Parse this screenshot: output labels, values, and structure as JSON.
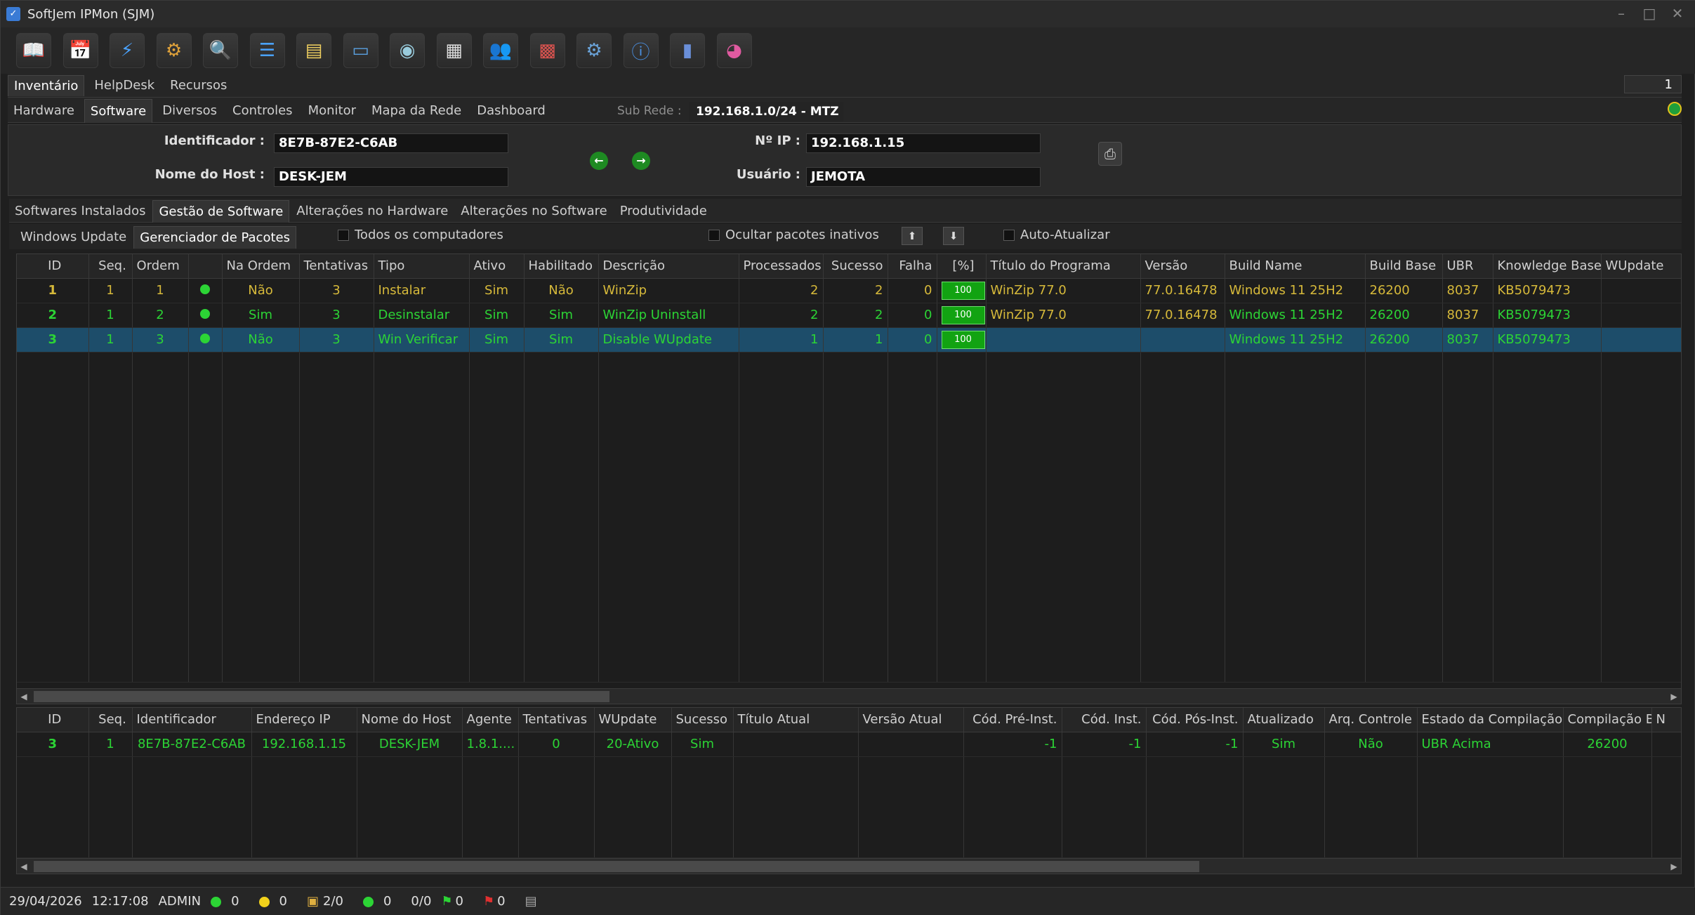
{
  "window": {
    "title": "SoftJem IPMon (SJM)"
  },
  "toolbar": {
    "icons": [
      "open-book-icon",
      "calendar-clock-icon",
      "lightning-icon",
      "gears-icon",
      "search-icon",
      "tree-add-icon",
      "notes-icon",
      "monitor-icon",
      "camera-icon",
      "clipboard-icon",
      "users-icon",
      "chart-report-icon",
      "settings-gear-icon",
      "info-icon",
      "exit-door-icon",
      "palette-icon"
    ]
  },
  "main_tabs": [
    "Inventário",
    "HelpDesk",
    "Recursos"
  ],
  "page_number": "1",
  "section_tabs": [
    "Hardware",
    "Software",
    "Diversos",
    "Controles",
    "Monitor",
    "Mapa da Rede",
    "Dashboard"
  ],
  "subnet": {
    "label": "Sub Rede :",
    "value": "192.168.1.0/24 - MTZ"
  },
  "host": {
    "id_label": "Identificador :",
    "id_value": "8E7B-87E2-C6AB",
    "name_label": "Nome do Host :",
    "name_value": "DESK-JEM",
    "ip_label": "Nº IP :",
    "ip_value": "192.168.1.15",
    "user_label": "Usuário :",
    "user_value": "JEMOTA"
  },
  "software_tabs": [
    "Softwares Instalados",
    "Gestão de Software",
    "Alterações no Hardware",
    "Alterações no Software",
    "Produtividade"
  ],
  "package_tabs": [
    "Windows Update",
    "Gerenciador de Pacotes"
  ],
  "options": {
    "all_computers": "Todos os computadores",
    "hide_inactive": "Ocultar pacotes inativos",
    "auto_update": "Auto-Atualizar"
  },
  "packages": {
    "columns": [
      "ID",
      "Seq.",
      "Ordem",
      "",
      "Na Ordem",
      "Tentativas",
      "Tipo",
      "Ativo",
      "Habilitado",
      "Descrição",
      "Processados",
      "Sucesso",
      "Falha",
      "[%]",
      "Título do Programa",
      "Versão",
      "Build Name",
      "Build Base",
      "UBR",
      "Knowledge Base",
      "WUpdate"
    ],
    "rows": [
      {
        "id": "1",
        "seq": "1",
        "ordem": "1",
        "na_ordem": "Não",
        "tentativas": "3",
        "tipo": "Instalar",
        "ativo": "Sim",
        "habilitado": "Não",
        "descricao": "WinZip",
        "processados": "2",
        "sucesso": "2",
        "falha": "0",
        "pct": "100",
        "titulo": "WinZip 77.0",
        "versao": "77.0.16478",
        "build_name": "Windows 11 25H2",
        "build_base": "26200",
        "ubr": "8037",
        "kb": "KB5079473",
        "wupdate": ""
      },
      {
        "id": "2",
        "seq": "1",
        "ordem": "2",
        "na_ordem": "Sim",
        "tentativas": "3",
        "tipo": "Desinstalar",
        "ativo": "Sim",
        "habilitado": "Sim",
        "descricao": "WinZip Uninstall",
        "processados": "2",
        "sucesso": "2",
        "falha": "0",
        "pct": "100",
        "titulo": "WinZip 77.0",
        "versao": "77.0.16478",
        "build_name": "Windows 11 25H2",
        "build_base": "26200",
        "ubr": "8037",
        "kb": "KB5079473",
        "wupdate": ""
      },
      {
        "id": "3",
        "seq": "1",
        "ordem": "3",
        "na_ordem": "Não",
        "tentativas": "3",
        "tipo": "Win Verificar",
        "ativo": "Sim",
        "habilitado": "Sim",
        "descricao": "Disable WUpdate",
        "processados": "1",
        "sucesso": "1",
        "falha": "0",
        "pct": "100",
        "titulo": "",
        "versao": "",
        "build_name": "Windows 11 25H2",
        "build_base": "26200",
        "ubr": "8037",
        "kb": "KB5079473",
        "wupdate": ""
      }
    ]
  },
  "targets": {
    "columns": [
      "ID",
      "Seq.",
      "Identificador",
      "Endereço IP",
      "Nome do Host",
      "Agente",
      "Tentativas",
      "WUpdate",
      "Sucesso",
      "Título Atual",
      "Versão Atual",
      "Cód. Pré-Inst.",
      "Cód. Inst.",
      "Cód. Pós-Inst.",
      "Atualizado",
      "Arq. Controle",
      "Estado da Compilação",
      "Compilação Base",
      "N"
    ],
    "rows": [
      {
        "id": "3",
        "seq": "1",
        "identificador": "8E7B-87E2-C6AB",
        "ip": "192.168.1.15",
        "host": "DESK-JEM",
        "agente": "1.8.1....",
        "tentativas": "0",
        "wupdate": "20-Ativo",
        "sucesso": "Sim",
        "titulo": "",
        "versao": "",
        "pre": "-1",
        "inst": "-1",
        "pos": "-1",
        "atualizado": "Sim",
        "arq": "Não",
        "estado": "UBR Acima",
        "base": "26200",
        "n": ""
      }
    ]
  },
  "status": {
    "date": "29/04/2026",
    "time": "12:17:08",
    "user": "ADMIN",
    "green_count": "0",
    "yellow_count": "0",
    "tasks": "2/0",
    "online": "0",
    "ratio": "0/0",
    "flag_green": "0",
    "flag_red": "0"
  },
  "colors": {
    "green_text": "#2cd435",
    "yellow_text": "#d6b93a",
    "selection": "#1d4d6a"
  }
}
